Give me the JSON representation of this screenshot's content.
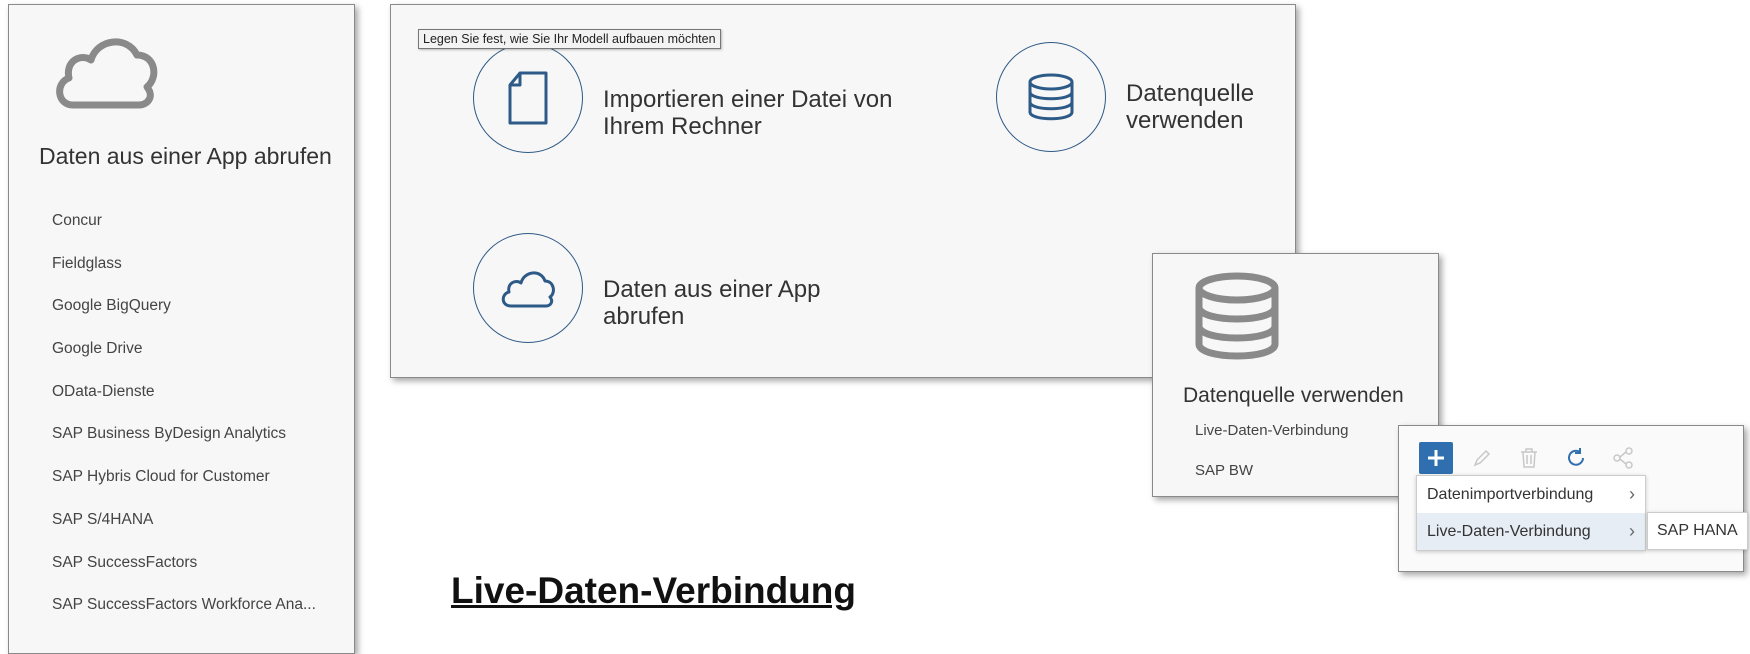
{
  "left_panel": {
    "icon": "cloud-icon",
    "title": "Daten aus einer App abrufen",
    "items": [
      {
        "label": "Concur"
      },
      {
        "label": "Fieldglass"
      },
      {
        "label": "Google BigQuery"
      },
      {
        "label": "Google Drive"
      },
      {
        "label": "OData-Dienste"
      },
      {
        "label": "SAP Business ByDesign Analytics"
      },
      {
        "label": "SAP Hybris Cloud for Customer"
      },
      {
        "label": "SAP S/4HANA"
      },
      {
        "label": "SAP SuccessFactors"
      },
      {
        "label": "SAP SuccessFactors Workforce Ana..."
      }
    ]
  },
  "main_panel": {
    "tooltip": "Legen Sie fest, wie Sie Ihr Modell aufbauen möchten",
    "options": {
      "import_file": {
        "label": "Importieren einer Datei von Ihrem Rechner",
        "icon": "file-icon"
      },
      "datasource": {
        "label": "Datenquelle verwenden",
        "icon": "database-icon"
      },
      "app": {
        "label": "Daten aus einer App abrufen",
        "icon": "cloud-icon"
      }
    }
  },
  "datasource_panel": {
    "icon": "database-icon",
    "title": "Datenquelle verwenden",
    "items": [
      {
        "label": "Live-Daten-Verbindung"
      },
      {
        "label": "SAP BW"
      }
    ]
  },
  "menu_panel": {
    "toolbar": [
      "add-icon",
      "edit-icon",
      "delete-icon",
      "refresh-icon",
      "share-icon"
    ],
    "dropdown": [
      {
        "label": "Datenimportverbindung"
      },
      {
        "label": "Live-Daten-Verbindung"
      }
    ],
    "submenu": {
      "label": "SAP HANA"
    },
    "accent": "#2f6fb0"
  },
  "caption": "Live-Daten-Verbindung"
}
